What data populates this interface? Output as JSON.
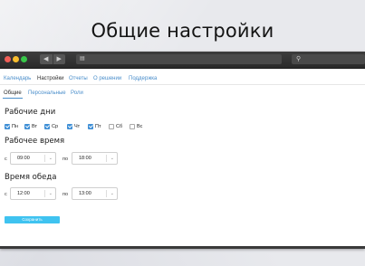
{
  "slide": {
    "title": "Общие настройки"
  },
  "window": {
    "nav_back": "◀",
    "nav_forward": "▶",
    "url_icon": "page-icon",
    "search_icon": "search-icon"
  },
  "menu": {
    "items": [
      {
        "label": "Календарь"
      },
      {
        "label": "Настройки"
      },
      {
        "label": "Отчеты"
      },
      {
        "label": "О решении"
      },
      {
        "label": "Поддержка"
      }
    ],
    "active_index": 1
  },
  "subtabs": {
    "items": [
      {
        "label": "Общие"
      },
      {
        "label": "Персональные"
      },
      {
        "label": "Роли"
      }
    ],
    "active_index": 0
  },
  "workdays": {
    "heading": "Рабочие дни",
    "days": [
      {
        "label": "Пн",
        "checked": true
      },
      {
        "label": "Вт",
        "checked": true
      },
      {
        "label": "Ср",
        "checked": true
      },
      {
        "label": "Чт",
        "checked": true
      },
      {
        "label": "Пт",
        "checked": true
      },
      {
        "label": "Сб",
        "checked": false
      },
      {
        "label": "Вс",
        "checked": false
      }
    ]
  },
  "worktime": {
    "heading": "Рабочее время",
    "from_label": "с",
    "from_value": "09:00",
    "to_label": "по",
    "to_value": "18:00"
  },
  "lunch": {
    "heading": "Время обеда",
    "from_label": "с",
    "from_value": "12:00",
    "to_label": "по",
    "to_value": "13:00"
  },
  "save_label": "Сохранить",
  "colors": {
    "accent": "#4a8ecb",
    "checkbox": "#3f8fd6",
    "save_button": "#3fc3f0"
  }
}
